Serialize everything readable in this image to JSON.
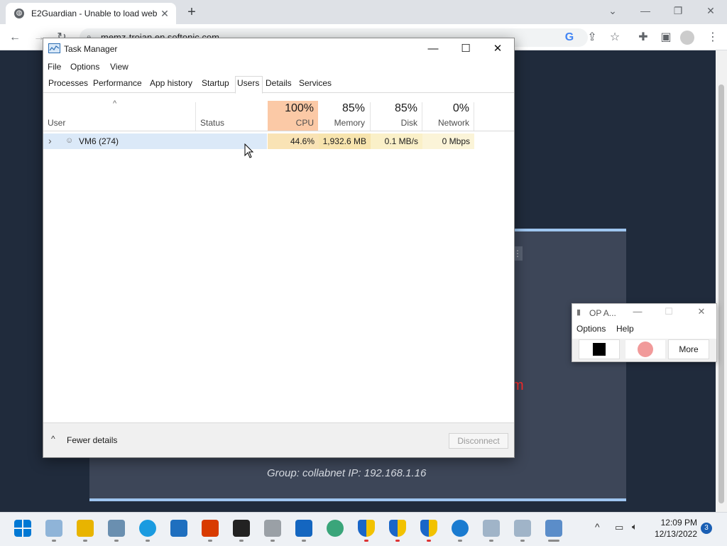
{
  "browser": {
    "tab_title": "E2Guardian - Unable to load web",
    "tab_close": "✕",
    "new_tab": "+",
    "url": "memz-trojan.en.softonic.com",
    "window_controls": {
      "collapse": "⌄",
      "minimize": "—",
      "restore": "❐",
      "close": "✕"
    },
    "toolbar_icons": [
      "back-icon",
      "forward-icon",
      "reload-icon",
      "lock-icon",
      "google-icon",
      "share-icon",
      "star-icon",
      "extensions-icon",
      "side-panel-icon",
      "profile-icon",
      "menu-icon"
    ]
  },
  "webpage": {
    "blocked_fragment": "m",
    "group_line": "Group: collabnet    IP: 192.168.1.16",
    "card_dots": "⋮"
  },
  "taskmgr": {
    "title": "Task Manager",
    "controls": {
      "minimize": "—",
      "maximize": "☐",
      "close": "✕"
    },
    "menus": [
      "File",
      "Options",
      "View"
    ],
    "tabs": [
      "Processes",
      "Performance",
      "App history",
      "Startup",
      "Users",
      "Details",
      "Services"
    ],
    "active_tab": "Users",
    "columns": {
      "user": "User",
      "status": "Status",
      "cpu": {
        "pct": "100%",
        "name": "CPU"
      },
      "memory": {
        "pct": "85%",
        "name": "Memory"
      },
      "disk": {
        "pct": "85%",
        "name": "Disk"
      },
      "network": {
        "pct": "0%",
        "name": "Network"
      }
    },
    "sort_arrow": "^",
    "rows": [
      {
        "expander": "›",
        "user": "VM6 (274)",
        "status": "",
        "cpu": "44.6%",
        "memory": "1,932.6 MB",
        "disk": "0.1 MB/s",
        "network": "0 Mbps"
      }
    ],
    "footer": {
      "fewer_details": "Fewer details",
      "fewer_caret": "^",
      "disconnect": "Disconnect"
    },
    "colors": {
      "cpu_header": "#fbc9a6",
      "cpu_cell": "#f9e3b5",
      "memory_cell": "#f7e4ae",
      "disk_cell": "#faf0c8",
      "network_cell": "#fbf4d8",
      "row_highlight": "#dbe9f8"
    }
  },
  "op_clicker": {
    "title": "OP A...",
    "controls": {
      "minimize": "—",
      "maximize": "☐",
      "close": "✕"
    },
    "menus": [
      "Options",
      "Help"
    ],
    "more_button": "More"
  },
  "taskbar": {
    "icons": [
      "windows-start-icon",
      "notepad-icon",
      "file-explorer-icon",
      "control-panel-icon",
      "edge-icon",
      "chat-icon",
      "office-icon",
      "terminal-icon",
      "mouse-clicker-icon",
      "store-icon",
      "paint-icon",
      "defender-shield-icon",
      "defender-shield-icon",
      "defender-shield-icon",
      "help-icon",
      "spinning-disk-icon",
      "spinning-disk-icon",
      "task-manager-icon"
    ],
    "tray_chevron": "^",
    "time": "12:09 PM",
    "date": "12/13/2022",
    "notifications": "3"
  }
}
